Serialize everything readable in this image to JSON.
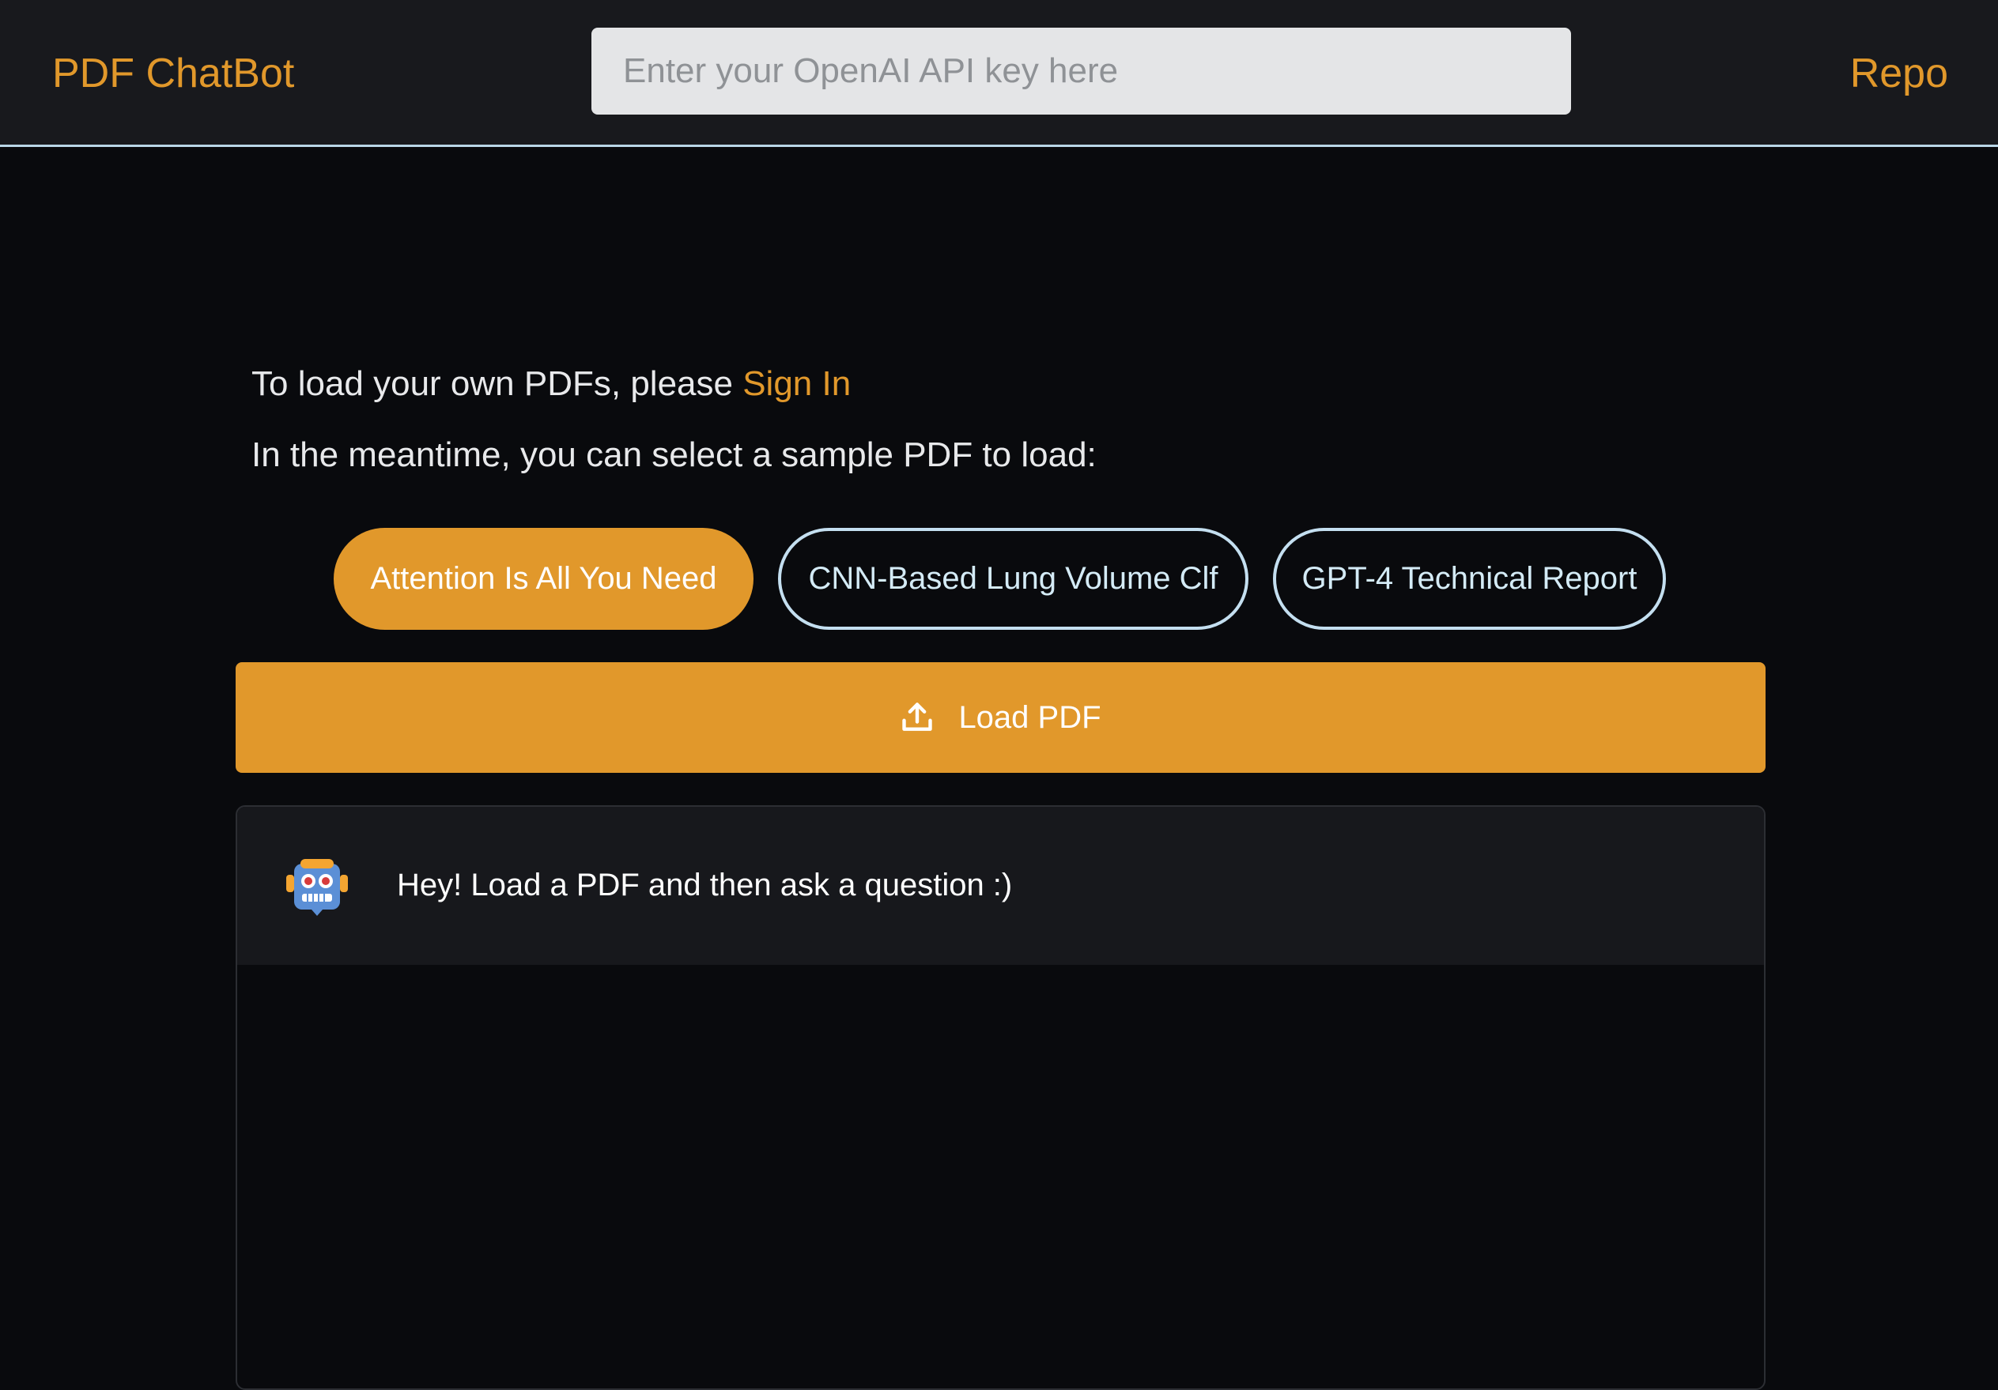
{
  "header": {
    "brand": "PDF ChatBot",
    "api_key_placeholder": "Enter your OpenAI API key here",
    "api_key_value": "",
    "repo_label": "Repo"
  },
  "intro": {
    "line1_prefix": "To load your own PDFs, please ",
    "sign_in_label": "Sign In",
    "line2": "In the meantime, you can select a sample PDF to load:"
  },
  "samples": [
    {
      "label": "Attention Is All You Need",
      "selected": true
    },
    {
      "label": "CNN-Based Lung Volume Clf",
      "selected": false
    },
    {
      "label": "GPT-4 Technical Report",
      "selected": false
    }
  ],
  "load_button": {
    "label": "Load PDF",
    "icon": "upload-icon"
  },
  "chat": {
    "messages": [
      {
        "sender": "bot",
        "avatar_icon": "robot-icon",
        "text": "Hey! Load a PDF and then ask a question :)"
      }
    ]
  },
  "colors": {
    "accent": "#e1982b",
    "header_bg": "#18191d",
    "page_bg": "#090a0d",
    "outline_button_border": "#c4dff0",
    "header_border": "#b9d6e6"
  }
}
